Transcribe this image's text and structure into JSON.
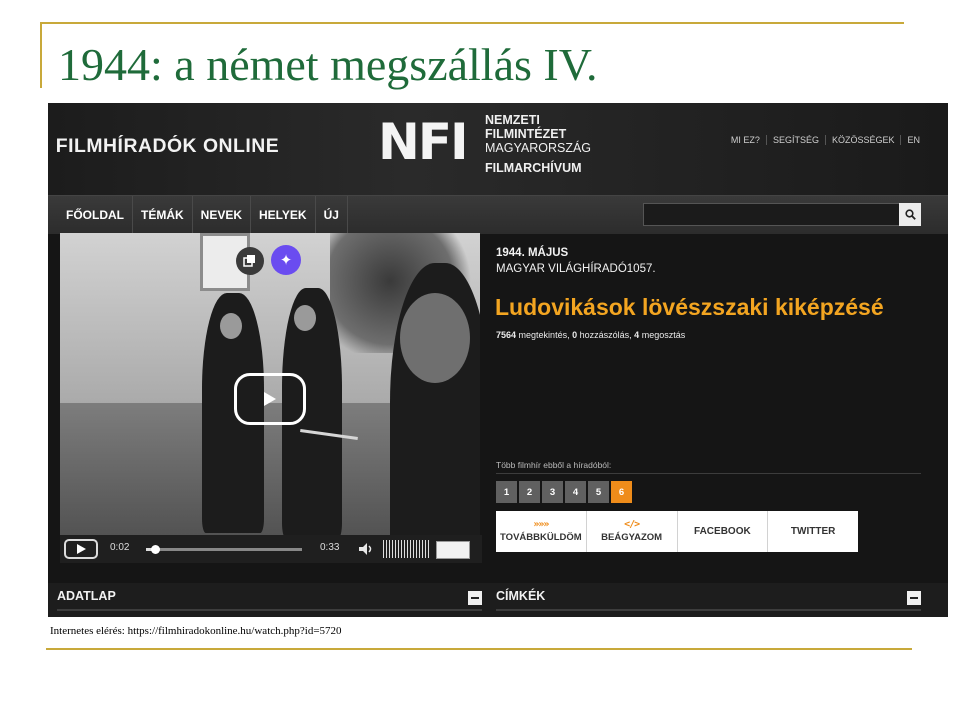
{
  "slide": {
    "title": "1944: a német megszállás IV.",
    "caption": "Internetes elérés: https://filmhiradokonline.hu/watch.php?id=5720"
  },
  "site": {
    "logo": "FILMHÍRADÓK ONLINE",
    "nfi_mark": "NFI",
    "nfi_lines": [
      "NEMZETI",
      "FILMINTÉZET",
      "MAGYARORSZÁG",
      "FILMARCHÍVUM"
    ],
    "top_links": [
      "MI EZ?",
      "SEGÍTSÉG",
      "KÖZÖSSÉGEK",
      "EN"
    ]
  },
  "nav": {
    "items": [
      "FŐOLDAL",
      "TÉMÁK",
      "NEVEK",
      "HELYEK",
      "ÚJ"
    ],
    "search_placeholder": ""
  },
  "video": {
    "time_current": "0:02",
    "time_total": "0:33",
    "progress": 0.06
  },
  "info": {
    "date": "1944. MÁJUS",
    "source": "MAGYAR VILÁGHÍRADÓ1057.",
    "title": "Ludovikások lövészszaki kiképzésé",
    "views": "7564",
    "views_label": "megtekintés,",
    "comments": "0",
    "comments_label": "hozzászólás,",
    "shares": "4",
    "shares_label": "megosztás",
    "more_label": "Több filmhír ebből a híradóból:",
    "pages": [
      "1",
      "2",
      "3",
      "4",
      "5",
      "6"
    ],
    "active_page": "6"
  },
  "share": {
    "forward": "TOVÁBBKÜLDÖM",
    "forward_icon": "»»»",
    "embed": "BEÁGYAZOM",
    "embed_icon": "</>",
    "facebook": "FACEBOOK",
    "twitter": "TWITTER"
  },
  "panels": {
    "left": "ADATLAP",
    "right": "CÍMKÉK"
  },
  "colors": {
    "title_green": "#1f6b3a",
    "rule_gold": "#c8a93a",
    "accent_orange": "#ef8c1a",
    "headline_orange": "#f3a521"
  }
}
